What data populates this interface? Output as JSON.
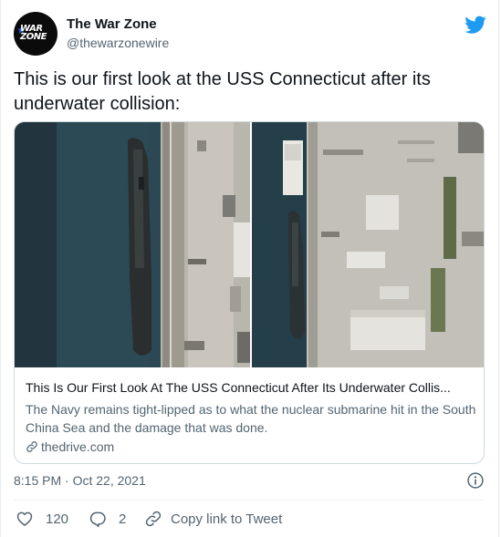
{
  "account": {
    "display_name": "The War Zone",
    "handle": "@thewarzonewire",
    "avatar_text": "WAR ZONE"
  },
  "tweet": {
    "text": "This is our first look at the USS Connecticut after its underwater collision:"
  },
  "card": {
    "title": "This Is Our First Look At The USS Connecticut After Its Underwater Collis...",
    "description": "The Navy remains tight-lipped as to what the nuclear submarine hit in the South China Sea and the damage that was done.",
    "domain": "thedrive.com"
  },
  "meta": {
    "timestamp": "8:15 PM · Oct 22, 2021"
  },
  "actions": {
    "like_count": "120",
    "reply_count": "2",
    "copy_link_label": "Copy link to Tweet"
  },
  "icons": {
    "brand": "twitter-bird-icon",
    "link": "link-icon",
    "info": "info-icon",
    "like": "heart-icon",
    "reply": "reply-icon",
    "copy": "link-icon"
  },
  "colors": {
    "twitter_blue": "#1d9bf0",
    "secondary_text": "#536471",
    "primary_text": "#0f1419",
    "border": "#cfd9de"
  }
}
